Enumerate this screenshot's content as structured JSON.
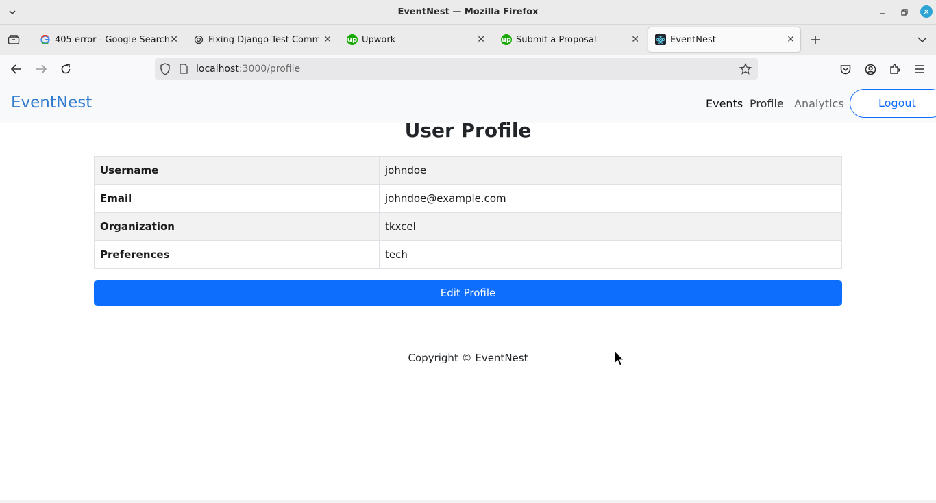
{
  "window": {
    "title": "EventNest — Mozilla Firefox"
  },
  "tabs": [
    {
      "label": "405 error - Google Search",
      "icon": "google-icon"
    },
    {
      "label": "Fixing Django Test Comman",
      "icon": "chatgpt-icon"
    },
    {
      "label": "Upwork",
      "icon": "upwork-icon"
    },
    {
      "label": "Submit a Proposal",
      "icon": "upwork-icon"
    },
    {
      "label": "EventNest",
      "icon": "react-icon",
      "active": true
    }
  ],
  "urlbar": {
    "host": "localhost",
    "path": ":3000/profile"
  },
  "app": {
    "brand": "EventNest",
    "nav": {
      "events": "Events",
      "profile": "Profile",
      "analytics": "Analytics",
      "logout": "Logout"
    },
    "page_title": "User Profile",
    "profile_rows": [
      {
        "label": "Username",
        "value": "johndoe"
      },
      {
        "label": "Email",
        "value": "johndoe@example.com"
      },
      {
        "label": "Organization",
        "value": "tkxcel"
      },
      {
        "label": "Preferences",
        "value": "tech"
      }
    ],
    "edit_button": "Edit Profile",
    "footer": "Copyright © EventNest"
  },
  "colors": {
    "primary": "#0d6efd",
    "brand": "#2f7bd0"
  }
}
